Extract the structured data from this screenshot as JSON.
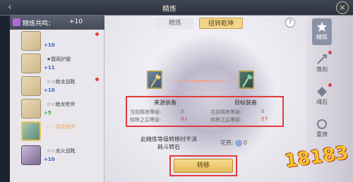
{
  "header": {
    "title": "精炼",
    "back_icon": "back-arrow-icon",
    "close_icon": "close-icon"
  },
  "left_panel": {
    "header_label": "精炼共鸣：",
    "header_bonus": "+10",
    "items": [
      {
        "name": "",
        "plus": "+10",
        "style": "gold"
      },
      {
        "name": "★霞雨护腿",
        "plus": "+11",
        "style": "gold"
      },
      {
        "name": "☆☆绝龙战靴",
        "plus": "+10",
        "style": "gold"
      },
      {
        "name": "☆☆绝龙枪斧",
        "plus": "+5",
        "style": "gold",
        "plus_color": "green"
      },
      {
        "name": "☆☆ 阴苔枪斧",
        "plus": "",
        "style": "green",
        "selected": true
      },
      {
        "name": "☆☆龙火战靴",
        "plus": "+10",
        "style": "purple"
      }
    ]
  },
  "tabs": [
    {
      "label": "精炼"
    },
    {
      "label": "扭转乾坤",
      "active": true
    }
  ],
  "help_label": "?",
  "source": {
    "title": "来源装备",
    "current_label": "当前精炼等级:",
    "current_value": "5",
    "after_label": "转移之后等级:",
    "after_value": "0↓"
  },
  "target": {
    "title": "目标装备",
    "current_label": "当前精炼等级:",
    "current_value": "0",
    "after_label": "转移之后等级:",
    "after_value": "5↑"
  },
  "notice_line1": "此精炼等级转移时不消",
  "notice_line2": "耗斗转石",
  "stone_label": "花费:",
  "stone_value": "0",
  "transfer_button": "转移",
  "right_nav": [
    {
      "label": "精炼",
      "icon": "forge-icon",
      "active": true
    },
    {
      "label": "镌刻",
      "icon": "engrave-icon"
    },
    {
      "label": "魂石",
      "icon": "soul-stone-icon"
    },
    {
      "label": "重铸",
      "icon": "recast-icon"
    }
  ],
  "watermark": "18183"
}
